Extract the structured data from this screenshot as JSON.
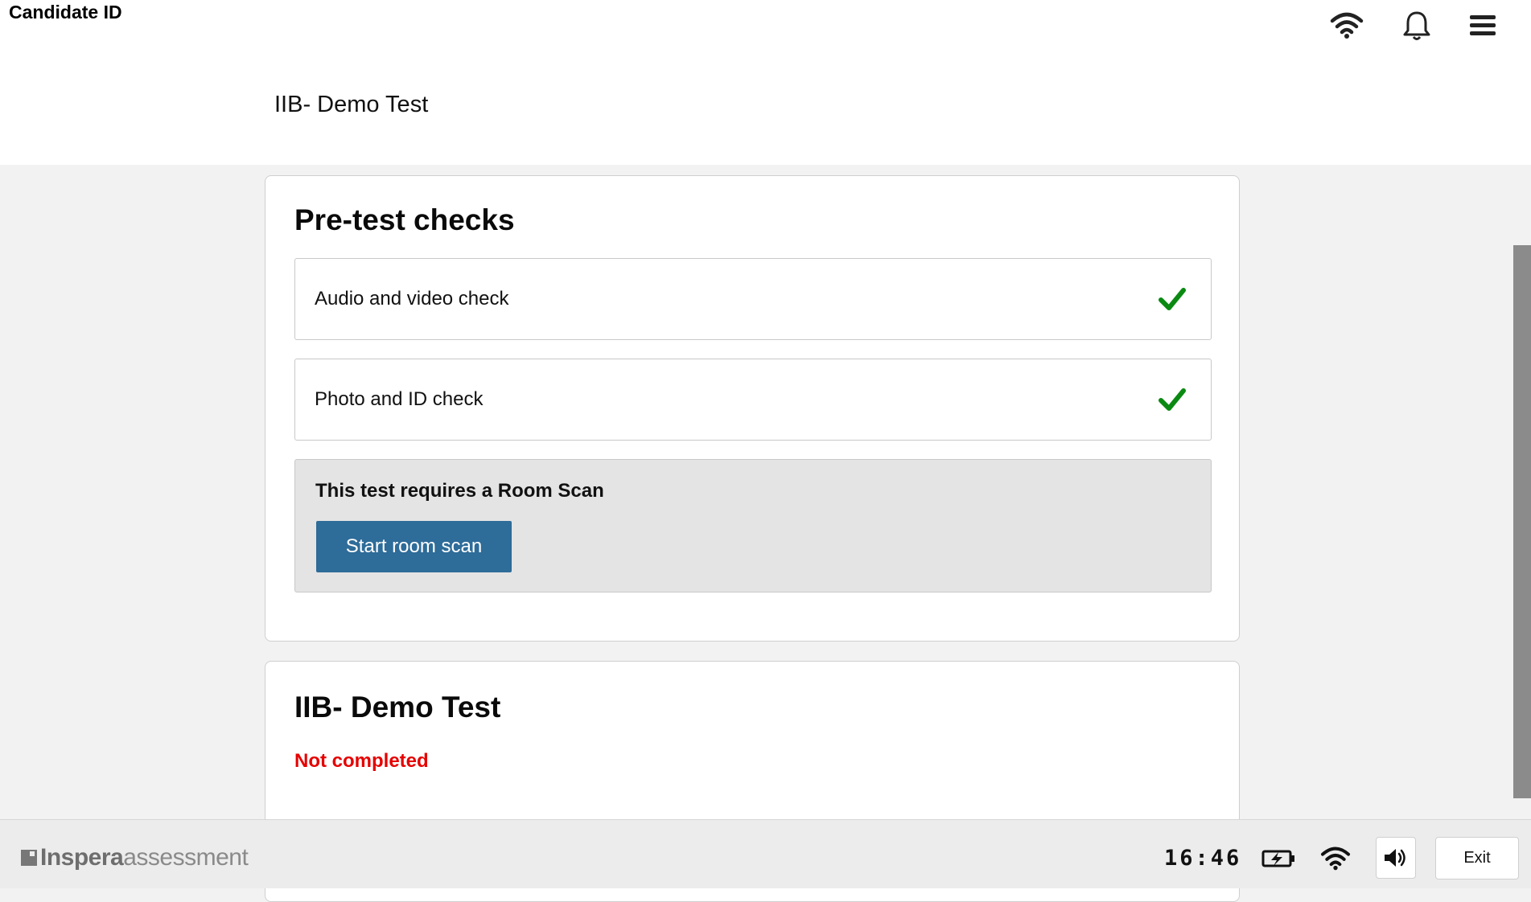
{
  "header": {
    "candidate_label": "Candidate ID",
    "test_title": "IIB- Demo Test",
    "icons": [
      "wifi-icon",
      "bell-icon",
      "menu-icon"
    ]
  },
  "pretest": {
    "title": "Pre-test checks",
    "checks": [
      {
        "label": "Audio and video check",
        "status": "passed"
      },
      {
        "label": "Photo and ID check",
        "status": "passed"
      }
    ],
    "room_scan": {
      "message": "This test requires a Room Scan",
      "button_label": "Start room scan"
    }
  },
  "test_card": {
    "title": "IIB- Demo Test",
    "status": "Not completed"
  },
  "footer": {
    "brand_bold": "Inspera",
    "brand_light": "assessment",
    "clock": "16:46",
    "exit_label": "Exit",
    "icons": [
      "battery-charging-icon",
      "wifi-icon",
      "volume-icon"
    ]
  },
  "colors": {
    "accent_button": "#2e6c99",
    "check_green": "#0a8a12",
    "status_red": "#e60000"
  }
}
